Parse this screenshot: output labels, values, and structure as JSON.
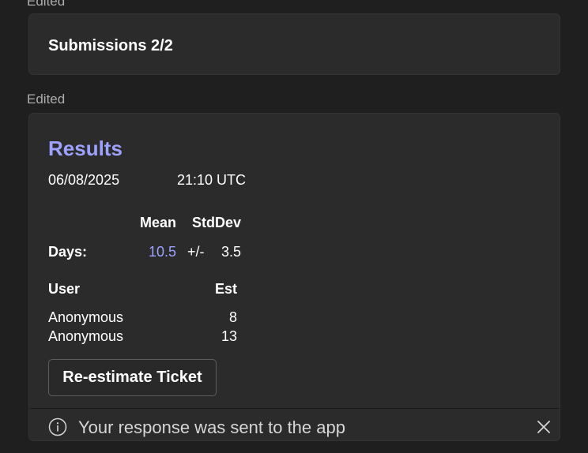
{
  "top_edited_label": "Edited",
  "submissions_card": {
    "title": "Submissions 2/2"
  },
  "results_edited_label": "Edited",
  "results_card": {
    "title": "Results",
    "date": "06/08/2025",
    "time": "21:10 UTC",
    "stats_header": {
      "mean": "Mean",
      "stddev": "StdDev"
    },
    "days_row": {
      "label": "Days:",
      "mean": "10.5",
      "plusminus": "+/-",
      "stddev": "3.5"
    },
    "users_header": {
      "user": "User",
      "est": "Est"
    },
    "users": [
      {
        "name": "Anonymous",
        "est": "8"
      },
      {
        "name": "Anonymous",
        "est": "13"
      }
    ],
    "reestimate_button": "Re-estimate Ticket"
  },
  "notification": {
    "icon": "info-icon",
    "text": "Your response was sent to the app",
    "close_icon": "close-icon"
  },
  "colors": {
    "background": "#1f1f1f",
    "card": "#2b2b2b",
    "accent": "#9ea2ff"
  }
}
